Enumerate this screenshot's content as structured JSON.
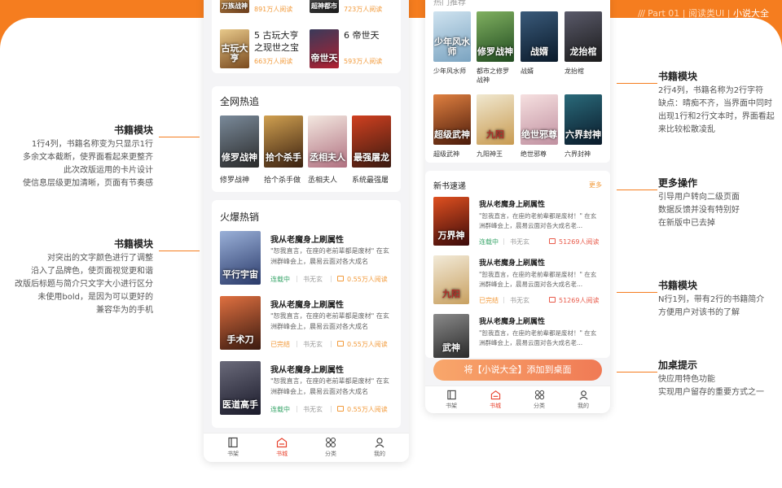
{
  "header": {
    "slashes": "///",
    "part": "Part 01 | 阅读类UI | ",
    "app": "小说大全"
  },
  "annotations": {
    "left1": {
      "title": "书籍模块",
      "lines": [
        "1行4列，书籍名称变为只显示1行",
        "多余文本截断，使界面看起来更整齐",
        "此次改版运用的卡片设计",
        "使信息层级更加清晰，页面有节奏感"
      ]
    },
    "left2": {
      "title": "书籍模块",
      "lines": [
        "对突出的文字颜色进行了调整",
        "沿入了品牌色，使页面视觉更和谐",
        "改版后标题与简介只文字大小进行区分",
        "未使用bold，是因为可以更好的",
        "兼容华为的手机"
      ]
    },
    "right1": {
      "title": "书籍模块",
      "lines": [
        "2行4列，书籍名称为2行字符",
        "缺点：晴痴不齐，当界面中同时",
        "出现1行和2行文本时，界面看起",
        "来比较松散凌乱"
      ]
    },
    "right2": {
      "title": "更多操作",
      "lines": [
        "引导用户转向二级页面",
        "数据反馈并没有特别好",
        "在新版中已去掉"
      ]
    },
    "right3": {
      "title": "书籍模块",
      "lines": [
        "N行1列，带有2行的书籍简介",
        "方便用户对该书的了解"
      ]
    },
    "right4": {
      "title": "加桌提示",
      "lines": [
        "快应用特色功能",
        "实现用户留存的重要方式之一"
      ]
    }
  },
  "left_phone": {
    "top_row": [
      {
        "cover_text": "万族战神",
        "reads": "891万人阅读"
      },
      {
        "cover_text": "超神都市",
        "reads": "723万人阅读"
      }
    ],
    "rank": [
      {
        "num_title": "5 古玩大亨之现世之宝",
        "cover_text": "古玩大亨",
        "reads": "663万人阅读"
      },
      {
        "num_title": "6 帝世天",
        "cover_text": "帝世天",
        "reads": "593万人阅读"
      }
    ],
    "hot_title": "全网热追",
    "hot_books": [
      {
        "name": "修罗战神",
        "cover_text": "修罗战神"
      },
      {
        "name": "拾个杀手做",
        "cover_text": "拾个杀手"
      },
      {
        "name": "丞相夫人",
        "cover_text": "丞相夫人"
      },
      {
        "name": "系统最强屠",
        "cover_text": "最强屠龙"
      }
    ],
    "fire_title": "火爆热销",
    "fire_books": [
      {
        "title": "我从老魔身上刷属性",
        "desc": "\"恕我直言，在座的老前辈都是废材\" 在玄洲群峰会上，晨易云面对各大成名",
        "status": "连载中",
        "author": "书无玄",
        "reads": "0.55万人阅读",
        "cover_text": "平行宇宙"
      },
      {
        "title": "我从老魔身上刷属性",
        "desc": "\"恕我直言，在座的老前辈都是废材\" 在玄洲群峰会上，晨易云面对各大成名",
        "status": "已完结",
        "author": "书无玄",
        "reads": "0.55万人阅读",
        "cover_text": "手术刀"
      },
      {
        "title": "我从老魔身上刷属性",
        "desc": "\"恕我直言，在座的老前辈都是废材\" 在玄洲群峰会上，晨易云面对各大成名",
        "status": "连载中",
        "author": "书无玄",
        "reads": "0.55万人阅读",
        "cover_text": "医道高手"
      }
    ],
    "tabs": [
      "书架",
      "书城",
      "分类",
      "我的"
    ]
  },
  "right_phone": {
    "partial_title": "热门推荐",
    "grid": [
      {
        "name": "少年风水师",
        "cover_text": "少年风水师"
      },
      {
        "name": "都市之修罗战神",
        "cover_text": "修罗战神"
      },
      {
        "name": "战婿",
        "cover_text": "战婿"
      },
      {
        "name": "龙抬棺",
        "cover_text": "龙抬棺"
      },
      {
        "name": "超级武神",
        "cover_text": "超级武神"
      },
      {
        "name": "九阳神王",
        "cover_text": "九阳"
      },
      {
        "name": "绝世邪尊",
        "cover_text": "绝世邪尊"
      },
      {
        "name": "六界封神",
        "cover_text": "六界封神"
      }
    ],
    "new_title": "新书速递",
    "more": "更多",
    "new_books": [
      {
        "title": "我从老魔身上刷属性",
        "desc": "\"恕我直言，在座的老前辈都是废材！\" 在玄洲群峰会上，晨易云面对各大成名老...",
        "status": "连载中",
        "author": "书无玄",
        "reads": "51269人阅读",
        "cover_text": "万界神"
      },
      {
        "title": "我从老魔身上刷属性",
        "desc": "\"恕我直言，在座的老前辈都是废材！\" 在玄洲群峰会上，晨易云面对各大成名老...",
        "status": "已完结",
        "author": "书无玄",
        "reads": "51269人阅读",
        "cover_text": "九阳"
      },
      {
        "title": "我从老魔身上刷属性",
        "desc": "\"恕我直言，在座的老前辈都是废材！\" 在玄洲群峰会上，晨易云面对各大成名老...",
        "status": "",
        "author": "",
        "reads": "",
        "cover_text": "武神"
      }
    ],
    "add_desk": "将【小说大全】添加到桌面",
    "tabs": [
      "书架",
      "书城",
      "分类",
      "我的"
    ]
  },
  "colors": {
    "accent": "#f57d1f",
    "serial": "#3aa66b",
    "finished": "#f29a3a"
  }
}
